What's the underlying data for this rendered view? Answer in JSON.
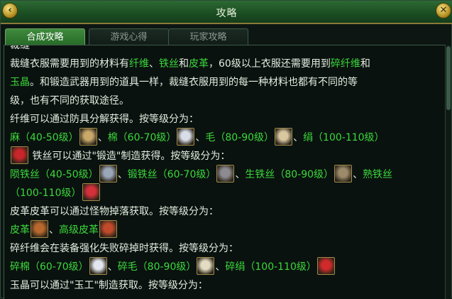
{
  "window": {
    "title": "攻略"
  },
  "tabs": [
    {
      "label": "合成攻略",
      "active": true
    },
    {
      "label": "游戏心得",
      "active": false
    },
    {
      "label": "玩家攻略",
      "active": false
    }
  ],
  "lines": [
    [
      {
        "t": "裁缝"
      }
    ],
    [
      {
        "t": "裁缝衣服需要用到的材料有"
      },
      {
        "t": "纤维",
        "g": true
      },
      {
        "t": "、"
      },
      {
        "t": "铁丝",
        "g": true
      },
      {
        "t": "和"
      },
      {
        "t": "皮革",
        "g": true
      },
      {
        "t": "，60级以上衣服还需要用到"
      },
      {
        "t": "碎纤维",
        "g": true
      },
      {
        "t": "和"
      }
    ],
    [
      {
        "t": "玉晶",
        "g": true
      },
      {
        "t": "。和锻造武器用到的道具一样，裁缝衣服用到的每一种材料也都有不同的等"
      }
    ],
    [
      {
        "t": "级，也有不同的获取途径。"
      }
    ],
    [
      {
        "t": "纤维可以通过防具分解获得。按等级分为："
      }
    ],
    [
      {
        "t": "麻（40-50级）",
        "g": true
      },
      {
        "i": "hemp-icon",
        "c": "#c9a86a"
      },
      {
        "t": "、"
      },
      {
        "t": "棉（60-70级）",
        "g": true
      },
      {
        "i": "cotton-icon",
        "c": "#d8dde8"
      },
      {
        "t": "、"
      },
      {
        "t": "毛（80-90级）",
        "g": true
      },
      {
        "i": "wool-icon",
        "c": "#d9c7a0"
      },
      {
        "t": "、"
      },
      {
        "t": "绢（100-110级）",
        "g": true
      }
    ],
    [
      {
        "i": "silk-icon",
        "c": "#c8262a"
      },
      {
        "t": " 铁丝可以通过\"锻造\"制造获得。按等级分为："
      }
    ],
    [
      {
        "t": "陨铁丝（40-50级）",
        "g": true
      },
      {
        "i": "meteor-wire-icon",
        "c": "#9aa7b8"
      },
      {
        "t": "、"
      },
      {
        "t": "锻铁丝（60-70级）",
        "g": true
      },
      {
        "i": "forged-wire-icon",
        "c": "#8e8a92"
      },
      {
        "t": "、"
      },
      {
        "t": "生铁丝（80-90级）",
        "g": true
      },
      {
        "i": "raw-wire-icon",
        "c": "#9c8a6a"
      },
      {
        "t": "、"
      },
      {
        "t": "熟铁丝",
        "g": true
      }
    ],
    [
      {
        "t": "（100-110级）",
        "g": true
      },
      {
        "i": "wrought-wire-icon",
        "c": "#d2303a"
      }
    ],
    [
      {
        "t": "皮革皮革可以通过怪物掉落获取。按等级分为："
      }
    ],
    [
      {
        "t": "皮革",
        "g": true
      },
      {
        "i": "leather-icon",
        "c": "#b8682e"
      },
      {
        "t": "、"
      },
      {
        "t": "高级皮革",
        "g": true
      },
      {
        "i": "premium-leather-icon",
        "c": "#c04a2a"
      }
    ],
    [
      {
        "t": "碎纤维会在装备强化失败碎掉时获得。按等级分为："
      }
    ],
    [
      {
        "t": "碎棉（60-70级）",
        "g": true
      },
      {
        "i": "broken-cotton-icon",
        "c": "#e2e6ee"
      },
      {
        "t": "、"
      },
      {
        "t": "碎毛（80-90级）",
        "g": true
      },
      {
        "i": "broken-wool-icon",
        "c": "#e4dcc2"
      },
      {
        "t": "、"
      },
      {
        "t": "碎绢（100-110级）",
        "g": true
      },
      {
        "i": "broken-silk-icon",
        "c": "#d02a2a"
      }
    ],
    [
      {
        "t": "玉晶可以通过\"玉工\"制造获取。按等级分为："
      }
    ]
  ]
}
